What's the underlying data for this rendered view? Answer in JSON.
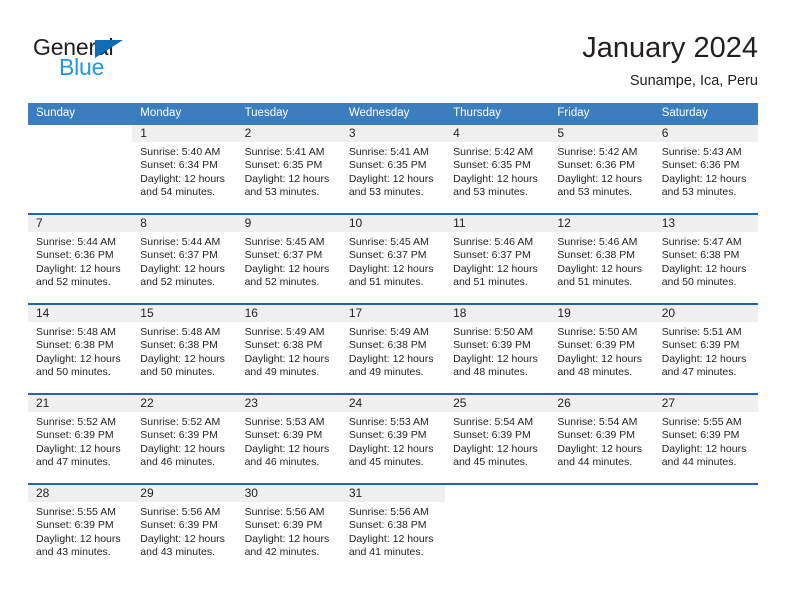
{
  "brand": {
    "name_part1": "General",
    "name_part2": "Blue",
    "icon": "triangle-logo-icon"
  },
  "header": {
    "title": "January 2024",
    "location": "Sunampe, Ica, Peru"
  },
  "colors": {
    "header_blue": "#3b7dbf",
    "row_divider": "#2265a8",
    "daynum_band": "#efefef",
    "brand_blue": "#2196e3",
    "brand_triangle": "#0f6cb5",
    "text": "#231f20"
  },
  "calendar": {
    "weekday_headers": [
      "Sunday",
      "Monday",
      "Tuesday",
      "Wednesday",
      "Thursday",
      "Friday",
      "Saturday"
    ],
    "weeks": [
      [
        {
          "day": "",
          "lines": []
        },
        {
          "day": "1",
          "lines": [
            "Sunrise: 5:40 AM",
            "Sunset: 6:34 PM",
            "Daylight: 12 hours",
            "and 54 minutes."
          ]
        },
        {
          "day": "2",
          "lines": [
            "Sunrise: 5:41 AM",
            "Sunset: 6:35 PM",
            "Daylight: 12 hours",
            "and 53 minutes."
          ]
        },
        {
          "day": "3",
          "lines": [
            "Sunrise: 5:41 AM",
            "Sunset: 6:35 PM",
            "Daylight: 12 hours",
            "and 53 minutes."
          ]
        },
        {
          "day": "4",
          "lines": [
            "Sunrise: 5:42 AM",
            "Sunset: 6:35 PM",
            "Daylight: 12 hours",
            "and 53 minutes."
          ]
        },
        {
          "day": "5",
          "lines": [
            "Sunrise: 5:42 AM",
            "Sunset: 6:36 PM",
            "Daylight: 12 hours",
            "and 53 minutes."
          ]
        },
        {
          "day": "6",
          "lines": [
            "Sunrise: 5:43 AM",
            "Sunset: 6:36 PM",
            "Daylight: 12 hours",
            "and 53 minutes."
          ]
        }
      ],
      [
        {
          "day": "7",
          "lines": [
            "Sunrise: 5:44 AM",
            "Sunset: 6:36 PM",
            "Daylight: 12 hours",
            "and 52 minutes."
          ]
        },
        {
          "day": "8",
          "lines": [
            "Sunrise: 5:44 AM",
            "Sunset: 6:37 PM",
            "Daylight: 12 hours",
            "and 52 minutes."
          ]
        },
        {
          "day": "9",
          "lines": [
            "Sunrise: 5:45 AM",
            "Sunset: 6:37 PM",
            "Daylight: 12 hours",
            "and 52 minutes."
          ]
        },
        {
          "day": "10",
          "lines": [
            "Sunrise: 5:45 AM",
            "Sunset: 6:37 PM",
            "Daylight: 12 hours",
            "and 51 minutes."
          ]
        },
        {
          "day": "11",
          "lines": [
            "Sunrise: 5:46 AM",
            "Sunset: 6:37 PM",
            "Daylight: 12 hours",
            "and 51 minutes."
          ]
        },
        {
          "day": "12",
          "lines": [
            "Sunrise: 5:46 AM",
            "Sunset: 6:38 PM",
            "Daylight: 12 hours",
            "and 51 minutes."
          ]
        },
        {
          "day": "13",
          "lines": [
            "Sunrise: 5:47 AM",
            "Sunset: 6:38 PM",
            "Daylight: 12 hours",
            "and 50 minutes."
          ]
        }
      ],
      [
        {
          "day": "14",
          "lines": [
            "Sunrise: 5:48 AM",
            "Sunset: 6:38 PM",
            "Daylight: 12 hours",
            "and 50 minutes."
          ]
        },
        {
          "day": "15",
          "lines": [
            "Sunrise: 5:48 AM",
            "Sunset: 6:38 PM",
            "Daylight: 12 hours",
            "and 50 minutes."
          ]
        },
        {
          "day": "16",
          "lines": [
            "Sunrise: 5:49 AM",
            "Sunset: 6:38 PM",
            "Daylight: 12 hours",
            "and 49 minutes."
          ]
        },
        {
          "day": "17",
          "lines": [
            "Sunrise: 5:49 AM",
            "Sunset: 6:38 PM",
            "Daylight: 12 hours",
            "and 49 minutes."
          ]
        },
        {
          "day": "18",
          "lines": [
            "Sunrise: 5:50 AM",
            "Sunset: 6:39 PM",
            "Daylight: 12 hours",
            "and 48 minutes."
          ]
        },
        {
          "day": "19",
          "lines": [
            "Sunrise: 5:50 AM",
            "Sunset: 6:39 PM",
            "Daylight: 12 hours",
            "and 48 minutes."
          ]
        },
        {
          "day": "20",
          "lines": [
            "Sunrise: 5:51 AM",
            "Sunset: 6:39 PM",
            "Daylight: 12 hours",
            "and 47 minutes."
          ]
        }
      ],
      [
        {
          "day": "21",
          "lines": [
            "Sunrise: 5:52 AM",
            "Sunset: 6:39 PM",
            "Daylight: 12 hours",
            "and 47 minutes."
          ]
        },
        {
          "day": "22",
          "lines": [
            "Sunrise: 5:52 AM",
            "Sunset: 6:39 PM",
            "Daylight: 12 hours",
            "and 46 minutes."
          ]
        },
        {
          "day": "23",
          "lines": [
            "Sunrise: 5:53 AM",
            "Sunset: 6:39 PM",
            "Daylight: 12 hours",
            "and 46 minutes."
          ]
        },
        {
          "day": "24",
          "lines": [
            "Sunrise: 5:53 AM",
            "Sunset: 6:39 PM",
            "Daylight: 12 hours",
            "and 45 minutes."
          ]
        },
        {
          "day": "25",
          "lines": [
            "Sunrise: 5:54 AM",
            "Sunset: 6:39 PM",
            "Daylight: 12 hours",
            "and 45 minutes."
          ]
        },
        {
          "day": "26",
          "lines": [
            "Sunrise: 5:54 AM",
            "Sunset: 6:39 PM",
            "Daylight: 12 hours",
            "and 44 minutes."
          ]
        },
        {
          "day": "27",
          "lines": [
            "Sunrise: 5:55 AM",
            "Sunset: 6:39 PM",
            "Daylight: 12 hours",
            "and 44 minutes."
          ]
        }
      ],
      [
        {
          "day": "28",
          "lines": [
            "Sunrise: 5:55 AM",
            "Sunset: 6:39 PM",
            "Daylight: 12 hours",
            "and 43 minutes."
          ]
        },
        {
          "day": "29",
          "lines": [
            "Sunrise: 5:56 AM",
            "Sunset: 6:39 PM",
            "Daylight: 12 hours",
            "and 43 minutes."
          ]
        },
        {
          "day": "30",
          "lines": [
            "Sunrise: 5:56 AM",
            "Sunset: 6:39 PM",
            "Daylight: 12 hours",
            "and 42 minutes."
          ]
        },
        {
          "day": "31",
          "lines": [
            "Sunrise: 5:56 AM",
            "Sunset: 6:38 PM",
            "Daylight: 12 hours",
            "and 41 minutes."
          ]
        },
        {
          "day": "",
          "lines": []
        },
        {
          "day": "",
          "lines": []
        },
        {
          "day": "",
          "lines": []
        }
      ]
    ]
  }
}
